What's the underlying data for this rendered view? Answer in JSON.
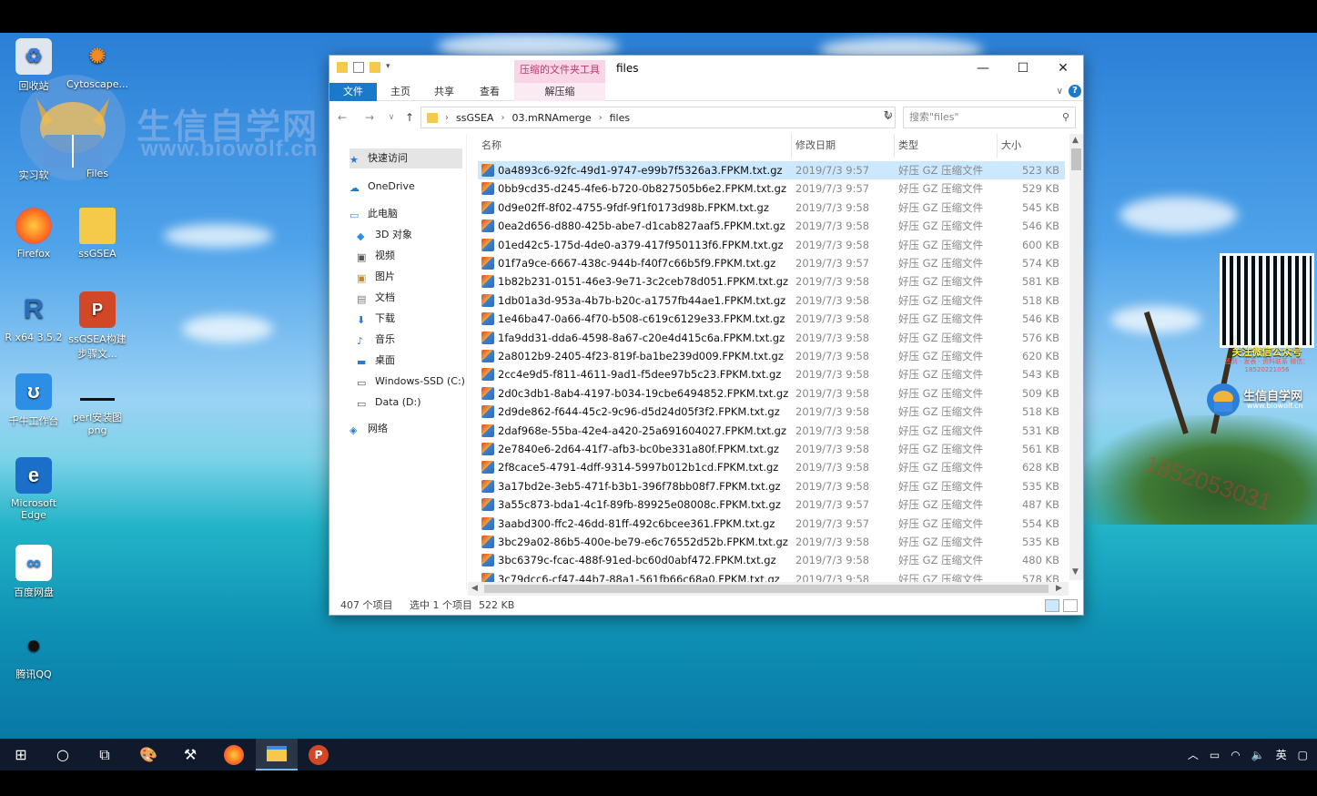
{
  "desktop": {
    "icons": [
      {
        "label": "回收站"
      },
      {
        "label": "Cytoscape..."
      },
      {
        "label": "实习软"
      },
      {
        "label": "Files"
      },
      {
        "label": "Firefox"
      },
      {
        "label": "ssGSEA"
      },
      {
        "label": "R x64 3.5.2"
      },
      {
        "label": "ssGSEA构建\n步骤文..."
      },
      {
        "label": "千牛工作台"
      },
      {
        "label": "perl安装图\npng"
      },
      {
        "label": "Microsoft\nEdge"
      },
      {
        "label": "百度网盘"
      },
      {
        "label": "腾讯QQ"
      }
    ],
    "watermark": {
      "title": "生信自学网",
      "url": "www.biowolf.cn"
    },
    "side_brand": {
      "qr_caption": "关注微信公众号",
      "qr_sub": "签到 · 发表 · 资料联系 微信：18520221056",
      "title": "生信自学网",
      "url": "www.biowolf.cn"
    },
    "phone_watermark": "1852053031"
  },
  "window": {
    "context_tab": "压缩的文件夹工具",
    "title": "files",
    "ribbon_tabs": [
      "文件",
      "主页",
      "共享",
      "查看"
    ],
    "context_subtab": "解压缩",
    "help": "?",
    "breadcrumb": [
      "ssGSEA",
      "03.mRNAmerge",
      "files"
    ],
    "search_placeholder": "搜索\"files\"",
    "nav": [
      {
        "label": "快速访问",
        "icon": "star-icon"
      },
      {
        "label": "OneDrive",
        "icon": "cloud-icon"
      },
      {
        "label": "此电脑",
        "icon": "pc-icon"
      },
      {
        "label": "3D 对象",
        "icon": "cube-icon"
      },
      {
        "label": "视频",
        "icon": "video-icon"
      },
      {
        "label": "图片",
        "icon": "picture-icon"
      },
      {
        "label": "文档",
        "icon": "document-icon"
      },
      {
        "label": "下载",
        "icon": "download-icon"
      },
      {
        "label": "音乐",
        "icon": "music-icon"
      },
      {
        "label": "桌面",
        "icon": "desktop-icon"
      },
      {
        "label": "Windows-SSD (C:)",
        "icon": "drive-icon"
      },
      {
        "label": "Data (D:)",
        "icon": "drive-icon"
      },
      {
        "label": "网络",
        "icon": "network-icon"
      }
    ],
    "columns": {
      "name": "名称",
      "date": "修改日期",
      "type": "类型",
      "size": "大小"
    },
    "files": [
      {
        "name": "0a4893c6-92fc-49d1-9747-e99b7f5326a3.FPKM.txt.gz",
        "date": "2019/7/3 9:57",
        "type": "好压 GZ 压缩文件",
        "size": "523 KB"
      },
      {
        "name": "0bb9cd35-d245-4fe6-b720-0b827505b6e2.FPKM.txt.gz",
        "date": "2019/7/3 9:57",
        "type": "好压 GZ 压缩文件",
        "size": "529 KB"
      },
      {
        "name": "0d9e02ff-8f02-4755-9fdf-9f1f0173d98b.FPKM.txt.gz",
        "date": "2019/7/3 9:58",
        "type": "好压 GZ 压缩文件",
        "size": "545 KB"
      },
      {
        "name": "0ea2d656-d880-425b-abe7-d1cab827aaf5.FPKM.txt.gz",
        "date": "2019/7/3 9:58",
        "type": "好压 GZ 压缩文件",
        "size": "546 KB"
      },
      {
        "name": "01ed42c5-175d-4de0-a379-417f950113f6.FPKM.txt.gz",
        "date": "2019/7/3 9:58",
        "type": "好压 GZ 压缩文件",
        "size": "600 KB"
      },
      {
        "name": "01f7a9ce-6667-438c-944b-f40f7c66b5f9.FPKM.txt.gz",
        "date": "2019/7/3 9:57",
        "type": "好压 GZ 压缩文件",
        "size": "574 KB"
      },
      {
        "name": "1b82b231-0151-46e3-9e71-3c2ceb78d051.FPKM.txt.gz",
        "date": "2019/7/3 9:58",
        "type": "好压 GZ 压缩文件",
        "size": "581 KB"
      },
      {
        "name": "1db01a3d-953a-4b7b-b20c-a1757fb44ae1.FPKM.txt.gz",
        "date": "2019/7/3 9:58",
        "type": "好压 GZ 压缩文件",
        "size": "518 KB"
      },
      {
        "name": "1e46ba47-0a66-4f70-b508-c619c6129e33.FPKM.txt.gz",
        "date": "2019/7/3 9:58",
        "type": "好压 GZ 压缩文件",
        "size": "546 KB"
      },
      {
        "name": "1fa9dd31-dda6-4598-8a67-c20e4d415c6a.FPKM.txt.gz",
        "date": "2019/7/3 9:58",
        "type": "好压 GZ 压缩文件",
        "size": "576 KB"
      },
      {
        "name": "2a8012b9-2405-4f23-819f-ba1be239d009.FPKM.txt.gz",
        "date": "2019/7/3 9:58",
        "type": "好压 GZ 压缩文件",
        "size": "620 KB"
      },
      {
        "name": "2cc4e9d5-f811-4611-9ad1-f5dee97b5c23.FPKM.txt.gz",
        "date": "2019/7/3 9:58",
        "type": "好压 GZ 压缩文件",
        "size": "543 KB"
      },
      {
        "name": "2d0c3db1-8ab4-4197-b034-19cbe6494852.FPKM.txt.gz",
        "date": "2019/7/3 9:58",
        "type": "好压 GZ 压缩文件",
        "size": "509 KB"
      },
      {
        "name": "2d9de862-f644-45c2-9c96-d5d24d05f3f2.FPKM.txt.gz",
        "date": "2019/7/3 9:58",
        "type": "好压 GZ 压缩文件",
        "size": "518 KB"
      },
      {
        "name": "2daf968e-55ba-42e4-a420-25a691604027.FPKM.txt.gz",
        "date": "2019/7/3 9:58",
        "type": "好压 GZ 压缩文件",
        "size": "531 KB"
      },
      {
        "name": "2e7840e6-2d64-41f7-afb3-bc0be331a80f.FPKM.txt.gz",
        "date": "2019/7/3 9:58",
        "type": "好压 GZ 压缩文件",
        "size": "561 KB"
      },
      {
        "name": "2f8cace5-4791-4dff-9314-5997b012b1cd.FPKM.txt.gz",
        "date": "2019/7/3 9:58",
        "type": "好压 GZ 压缩文件",
        "size": "628 KB"
      },
      {
        "name": "3a17bd2e-3eb5-471f-b3b1-396f78bb08f7.FPKM.txt.gz",
        "date": "2019/7/3 9:58",
        "type": "好压 GZ 压缩文件",
        "size": "535 KB"
      },
      {
        "name": "3a55c873-bda1-4c1f-89fb-89925e08008c.FPKM.txt.gz",
        "date": "2019/7/3 9:57",
        "type": "好压 GZ 压缩文件",
        "size": "487 KB"
      },
      {
        "name": "3aabd300-ffc2-46dd-81ff-492c6bcee361.FPKM.txt.gz",
        "date": "2019/7/3 9:57",
        "type": "好压 GZ 压缩文件",
        "size": "554 KB"
      },
      {
        "name": "3bc29a02-86b5-400e-be79-e6c76552d52b.FPKM.txt.gz",
        "date": "2019/7/3 9:58",
        "type": "好压 GZ 压缩文件",
        "size": "535 KB"
      },
      {
        "name": "3bc6379c-fcac-488f-91ed-bc60d0abf472.FPKM.txt.gz",
        "date": "2019/7/3 9:58",
        "type": "好压 GZ 压缩文件",
        "size": "480 KB"
      },
      {
        "name": "3c79dcc6-cf47-44b7-88a1-561fb66c68a0.FPKM.txt.gz",
        "date": "2019/7/3 9:58",
        "type": "好压 GZ 压缩文件",
        "size": "578 KB"
      }
    ],
    "status": {
      "count": "407 个项目",
      "selected": "选中 1 个项目",
      "size": "522 KB"
    }
  },
  "taskbar": {
    "items": [
      "start-icon",
      "search-icon",
      "task-view-icon",
      "paint-icon",
      "tool-icon",
      "firefox-icon",
      "file-explorer-icon",
      "powerpoint-icon"
    ],
    "tray_lang": "英"
  }
}
